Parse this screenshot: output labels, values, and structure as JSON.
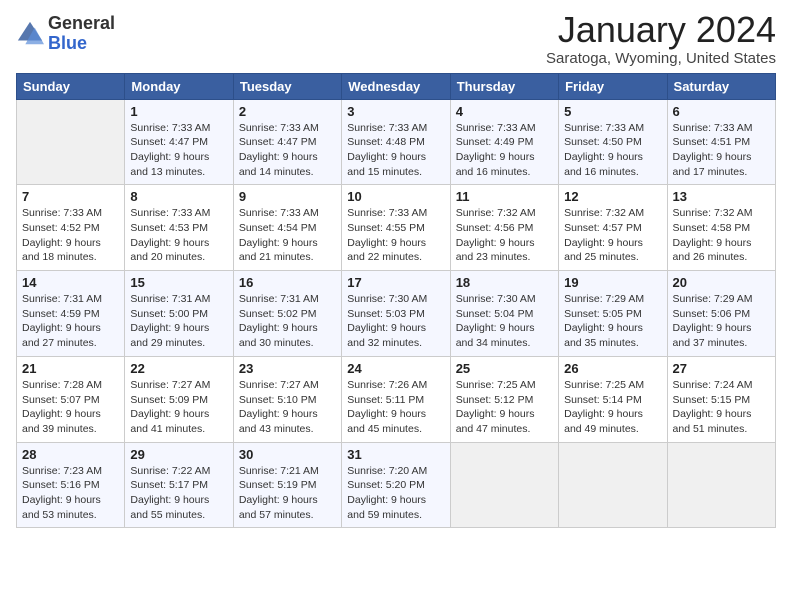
{
  "header": {
    "logo_general": "General",
    "logo_blue": "Blue",
    "month_title": "January 2024",
    "subtitle": "Saratoga, Wyoming, United States"
  },
  "days_of_week": [
    "Sunday",
    "Monday",
    "Tuesday",
    "Wednesday",
    "Thursday",
    "Friday",
    "Saturday"
  ],
  "weeks": [
    [
      {
        "day": "",
        "sunrise": "",
        "sunset": "",
        "daylight": ""
      },
      {
        "day": "1",
        "sunrise": "Sunrise: 7:33 AM",
        "sunset": "Sunset: 4:47 PM",
        "daylight": "Daylight: 9 hours and 13 minutes."
      },
      {
        "day": "2",
        "sunrise": "Sunrise: 7:33 AM",
        "sunset": "Sunset: 4:47 PM",
        "daylight": "Daylight: 9 hours and 14 minutes."
      },
      {
        "day": "3",
        "sunrise": "Sunrise: 7:33 AM",
        "sunset": "Sunset: 4:48 PM",
        "daylight": "Daylight: 9 hours and 15 minutes."
      },
      {
        "day": "4",
        "sunrise": "Sunrise: 7:33 AM",
        "sunset": "Sunset: 4:49 PM",
        "daylight": "Daylight: 9 hours and 16 minutes."
      },
      {
        "day": "5",
        "sunrise": "Sunrise: 7:33 AM",
        "sunset": "Sunset: 4:50 PM",
        "daylight": "Daylight: 9 hours and 16 minutes."
      },
      {
        "day": "6",
        "sunrise": "Sunrise: 7:33 AM",
        "sunset": "Sunset: 4:51 PM",
        "daylight": "Daylight: 9 hours and 17 minutes."
      }
    ],
    [
      {
        "day": "7",
        "sunrise": "Sunrise: 7:33 AM",
        "sunset": "Sunset: 4:52 PM",
        "daylight": "Daylight: 9 hours and 18 minutes."
      },
      {
        "day": "8",
        "sunrise": "Sunrise: 7:33 AM",
        "sunset": "Sunset: 4:53 PM",
        "daylight": "Daylight: 9 hours and 20 minutes."
      },
      {
        "day": "9",
        "sunrise": "Sunrise: 7:33 AM",
        "sunset": "Sunset: 4:54 PM",
        "daylight": "Daylight: 9 hours and 21 minutes."
      },
      {
        "day": "10",
        "sunrise": "Sunrise: 7:33 AM",
        "sunset": "Sunset: 4:55 PM",
        "daylight": "Daylight: 9 hours and 22 minutes."
      },
      {
        "day": "11",
        "sunrise": "Sunrise: 7:32 AM",
        "sunset": "Sunset: 4:56 PM",
        "daylight": "Daylight: 9 hours and 23 minutes."
      },
      {
        "day": "12",
        "sunrise": "Sunrise: 7:32 AM",
        "sunset": "Sunset: 4:57 PM",
        "daylight": "Daylight: 9 hours and 25 minutes."
      },
      {
        "day": "13",
        "sunrise": "Sunrise: 7:32 AM",
        "sunset": "Sunset: 4:58 PM",
        "daylight": "Daylight: 9 hours and 26 minutes."
      }
    ],
    [
      {
        "day": "14",
        "sunrise": "Sunrise: 7:31 AM",
        "sunset": "Sunset: 4:59 PM",
        "daylight": "Daylight: 9 hours and 27 minutes."
      },
      {
        "day": "15",
        "sunrise": "Sunrise: 7:31 AM",
        "sunset": "Sunset: 5:00 PM",
        "daylight": "Daylight: 9 hours and 29 minutes."
      },
      {
        "day": "16",
        "sunrise": "Sunrise: 7:31 AM",
        "sunset": "Sunset: 5:02 PM",
        "daylight": "Daylight: 9 hours and 30 minutes."
      },
      {
        "day": "17",
        "sunrise": "Sunrise: 7:30 AM",
        "sunset": "Sunset: 5:03 PM",
        "daylight": "Daylight: 9 hours and 32 minutes."
      },
      {
        "day": "18",
        "sunrise": "Sunrise: 7:30 AM",
        "sunset": "Sunset: 5:04 PM",
        "daylight": "Daylight: 9 hours and 34 minutes."
      },
      {
        "day": "19",
        "sunrise": "Sunrise: 7:29 AM",
        "sunset": "Sunset: 5:05 PM",
        "daylight": "Daylight: 9 hours and 35 minutes."
      },
      {
        "day": "20",
        "sunrise": "Sunrise: 7:29 AM",
        "sunset": "Sunset: 5:06 PM",
        "daylight": "Daylight: 9 hours and 37 minutes."
      }
    ],
    [
      {
        "day": "21",
        "sunrise": "Sunrise: 7:28 AM",
        "sunset": "Sunset: 5:07 PM",
        "daylight": "Daylight: 9 hours and 39 minutes."
      },
      {
        "day": "22",
        "sunrise": "Sunrise: 7:27 AM",
        "sunset": "Sunset: 5:09 PM",
        "daylight": "Daylight: 9 hours and 41 minutes."
      },
      {
        "day": "23",
        "sunrise": "Sunrise: 7:27 AM",
        "sunset": "Sunset: 5:10 PM",
        "daylight": "Daylight: 9 hours and 43 minutes."
      },
      {
        "day": "24",
        "sunrise": "Sunrise: 7:26 AM",
        "sunset": "Sunset: 5:11 PM",
        "daylight": "Daylight: 9 hours and 45 minutes."
      },
      {
        "day": "25",
        "sunrise": "Sunrise: 7:25 AM",
        "sunset": "Sunset: 5:12 PM",
        "daylight": "Daylight: 9 hours and 47 minutes."
      },
      {
        "day": "26",
        "sunrise": "Sunrise: 7:25 AM",
        "sunset": "Sunset: 5:14 PM",
        "daylight": "Daylight: 9 hours and 49 minutes."
      },
      {
        "day": "27",
        "sunrise": "Sunrise: 7:24 AM",
        "sunset": "Sunset: 5:15 PM",
        "daylight": "Daylight: 9 hours and 51 minutes."
      }
    ],
    [
      {
        "day": "28",
        "sunrise": "Sunrise: 7:23 AM",
        "sunset": "Sunset: 5:16 PM",
        "daylight": "Daylight: 9 hours and 53 minutes."
      },
      {
        "day": "29",
        "sunrise": "Sunrise: 7:22 AM",
        "sunset": "Sunset: 5:17 PM",
        "daylight": "Daylight: 9 hours and 55 minutes."
      },
      {
        "day": "30",
        "sunrise": "Sunrise: 7:21 AM",
        "sunset": "Sunset: 5:19 PM",
        "daylight": "Daylight: 9 hours and 57 minutes."
      },
      {
        "day": "31",
        "sunrise": "Sunrise: 7:20 AM",
        "sunset": "Sunset: 5:20 PM",
        "daylight": "Daylight: 9 hours and 59 minutes."
      },
      {
        "day": "",
        "sunrise": "",
        "sunset": "",
        "daylight": ""
      },
      {
        "day": "",
        "sunrise": "",
        "sunset": "",
        "daylight": ""
      },
      {
        "day": "",
        "sunrise": "",
        "sunset": "",
        "daylight": ""
      }
    ]
  ]
}
